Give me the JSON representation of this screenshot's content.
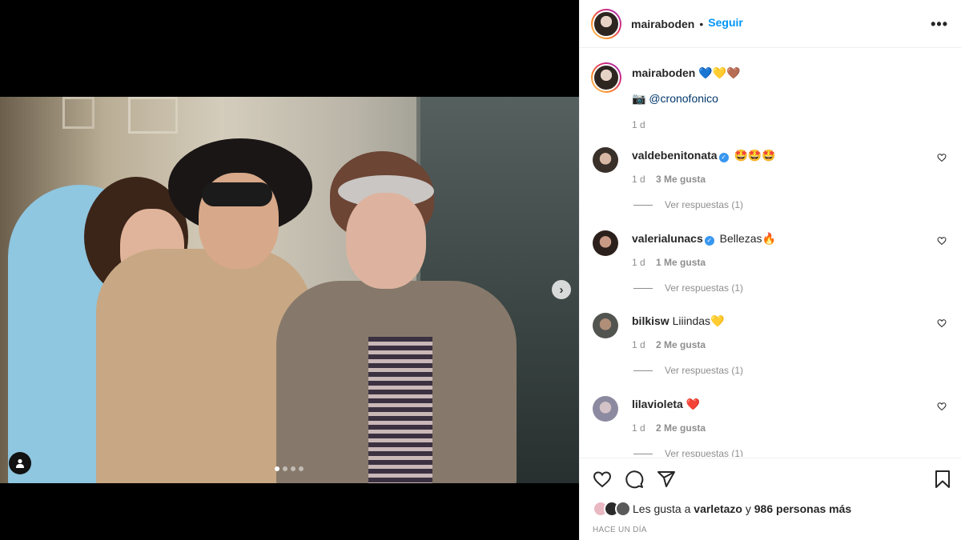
{
  "post": {
    "author": "mairaboden",
    "separator": "•",
    "follow_label": "Seguir",
    "more_label": "•••",
    "image_count": 4,
    "active_image_index": 0,
    "next_label": "›"
  },
  "caption": {
    "username": "mairaboden",
    "emojis": "💙💛🤎",
    "credit_icon": "📷",
    "mention": "@cronofonico",
    "time": "1 d"
  },
  "comments": [
    {
      "username": "valdebenitonata",
      "verified": true,
      "text": "🤩🤩🤩",
      "time": "1 d",
      "likes": "3 Me gusta",
      "replies": "Ver respuestas (1)"
    },
    {
      "username": "valerialunacs",
      "verified": true,
      "text": "Bellezas🔥",
      "time": "1 d",
      "likes": "1 Me gusta",
      "replies": "Ver respuestas (1)"
    },
    {
      "username": "bilkisw",
      "verified": false,
      "text": "Liiindas💛",
      "time": "1 d",
      "likes": "2 Me gusta",
      "replies": "Ver respuestas (1)"
    },
    {
      "username": "lilavioleta",
      "verified": false,
      "text": "❤️",
      "time": "1 d",
      "likes": "2 Me gusta",
      "replies": "Ver respuestas (1)"
    }
  ],
  "likes": {
    "prefix": "Les gusta a",
    "user": "varletazo",
    "connector": "y",
    "others": "986 personas más"
  },
  "timestamp": "HACE UN DÍA",
  "icons": [
    "heart-icon",
    "comment-icon",
    "share-icon",
    "bookmark-icon",
    "user-tag-icon",
    "chevron-right-icon",
    "verified-icon"
  ]
}
